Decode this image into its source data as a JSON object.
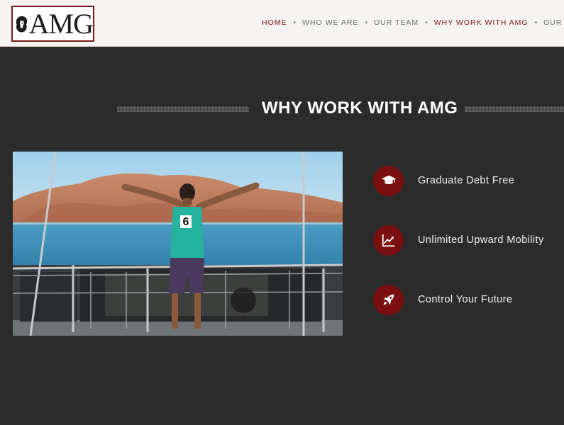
{
  "header": {
    "logo_text": "AMG",
    "nav": [
      {
        "label": "HOME",
        "active": true
      },
      {
        "label": "WHO WE ARE",
        "active": false
      },
      {
        "label": "OUR TEAM",
        "active": false
      },
      {
        "label": "WHY WORK WITH AMG",
        "active": true
      },
      {
        "label": "OUR CUSTOMERS",
        "active": false
      }
    ]
  },
  "section": {
    "title": "WHY WORK WITH AMG",
    "features": [
      {
        "icon": "graduation-cap-icon",
        "label": "Graduate Debt Free"
      },
      {
        "icon": "trending-chart-icon",
        "label": "Unlimited Upward Mobility"
      },
      {
        "icon": "rocket-icon",
        "label": "Control Your Future"
      }
    ],
    "photo": {
      "jersey_number": "6"
    }
  },
  "colors": {
    "accent": "#7a0f0f",
    "background": "#2b2b2b",
    "header_bg": "#f6f4f0"
  }
}
